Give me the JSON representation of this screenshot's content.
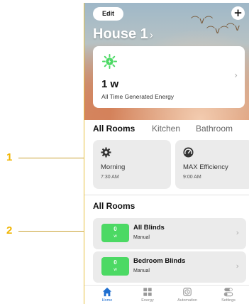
{
  "callouts": [
    "1",
    "2"
  ],
  "header": {
    "edit_label": "Edit",
    "add_label": "+",
    "house_title": "House 1",
    "house_chevron": "›"
  },
  "energy": {
    "value": "1 w",
    "label": "All Time Generated Energy",
    "icon": "solar-energy-icon",
    "accent_color": "#4cd964"
  },
  "tabs": [
    "All Rooms",
    "Kitchen",
    "Bathroom"
  ],
  "scenes": [
    {
      "name": "Morning",
      "time": "7:30 AM",
      "icon": "gear-icon"
    },
    {
      "name": "MAX Efficiency",
      "time": "9:00 AM",
      "icon": "gauge-icon"
    }
  ],
  "rooms": {
    "title": "All Rooms",
    "items": [
      {
        "badge_value": "0",
        "badge_unit": "w",
        "name": "All Blinds",
        "mode": "Manual"
      },
      {
        "badge_value": "0",
        "badge_unit": "w",
        "name": "Bedroom Blinds",
        "mode": "Manual"
      }
    ]
  },
  "nav": [
    {
      "label": "Home",
      "icon": "home-icon",
      "active": true
    },
    {
      "label": "Energy",
      "icon": "grid-icon",
      "active": false
    },
    {
      "label": "Automation",
      "icon": "clock-icon",
      "active": false
    },
    {
      "label": "Settings",
      "icon": "toggles-icon",
      "active": false
    }
  ],
  "colors": {
    "accent_green": "#4cd964",
    "active_nav": "#1f6fd0",
    "callout": "#f0b400"
  }
}
